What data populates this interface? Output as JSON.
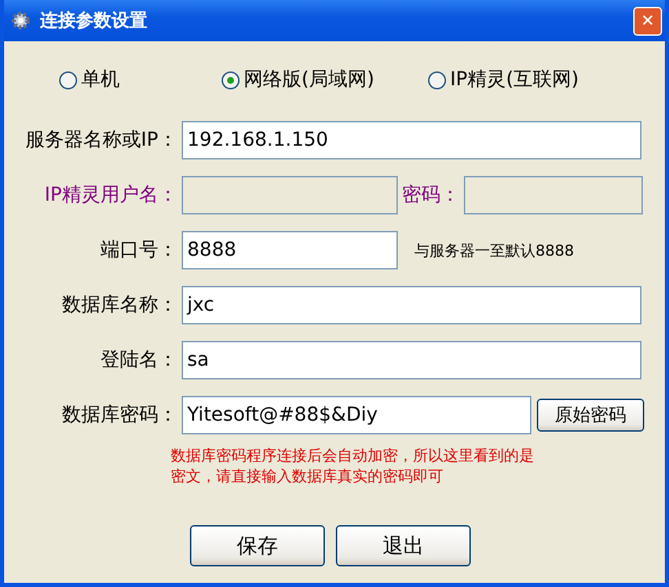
{
  "window": {
    "title": "连接参数设置",
    "close": "✕"
  },
  "modes": [
    {
      "label": "单机",
      "selected": false
    },
    {
      "label": "网络版(局域网)",
      "selected": true
    },
    {
      "label": "IP精灵(互联网)",
      "selected": false
    }
  ],
  "rows": [
    {
      "kind": "field",
      "label": "服务器名称或IP：",
      "value": "192.168.1.150",
      "disabled": false
    },
    {
      "kind": "pair",
      "label": "IP精灵用户名：",
      "disabled": true,
      "second_label": "密码："
    },
    {
      "kind": "hint",
      "label": "端口号：",
      "value": "8888",
      "disabled": false,
      "hint": "与服务器一至默认8888"
    },
    {
      "kind": "field",
      "label": "数据库名称：",
      "value": "jxc",
      "disabled": false
    },
    {
      "kind": "field",
      "label": "登陆名：",
      "value": "sa",
      "disabled": false
    },
    {
      "kind": "button",
      "label": "数据库密码：",
      "value": "Yitesoft@#88$&Diy",
      "disabled": false,
      "button": "原始密码"
    }
  ],
  "note": "数据库密码程序连接后会自动加密，所以这里看到的是密文，请直接输入数据库真实的密码即可",
  "buttons": [
    "保存",
    "退出"
  ]
}
